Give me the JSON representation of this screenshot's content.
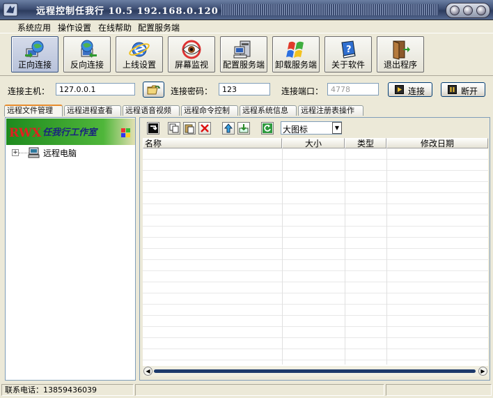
{
  "window": {
    "title": "远程控制任我行 10.5  192.168.0.120",
    "icon": "app-logo-icon"
  },
  "menu": [
    "系统应用",
    "操作设置",
    "在线帮助",
    "配置服务端"
  ],
  "toolbar": [
    {
      "label": "正向连接",
      "icon": "globe-connect-icon",
      "active": true
    },
    {
      "label": "反向连接",
      "icon": "globe-reverse-icon",
      "active": false
    },
    {
      "label": "上线设置",
      "icon": "ie-globe-icon",
      "active": false
    },
    {
      "label": "屏幕监视",
      "icon": "eye-monitor-icon",
      "active": false
    },
    {
      "label": "配置服务端",
      "icon": "computer-config-icon",
      "active": false
    },
    {
      "label": "卸载服务端",
      "icon": "uninstall-flag-icon",
      "active": false
    },
    {
      "label": "关于软件",
      "icon": "help-book-icon",
      "active": false
    },
    {
      "label": "退出程序",
      "icon": "exit-door-icon",
      "active": false
    }
  ],
  "connection": {
    "host_label": "连接主机：",
    "host_value": "127.0.0.1",
    "password_label": "连接密码：",
    "password_value": "123",
    "port_label": "连接端口：",
    "port_value": "4778",
    "connect_label": "连接",
    "disconnect_label": "断开"
  },
  "tabs": [
    "远程文件管理",
    "远程进程查看",
    "远程语音视频",
    "远程命令控制",
    "远程系统信息",
    "远程注册表操作"
  ],
  "banner": {
    "text": "任我行工作室",
    "logo": "RWX"
  },
  "tree": {
    "root": "远程电脑",
    "expander": "+"
  },
  "file_toolbar": {
    "view_select": "大图标"
  },
  "columns": [
    "名称",
    "大小",
    "类型",
    "修改日期"
  ],
  "status": {
    "phone": "联系电话：13859436039"
  },
  "colors": {
    "title_bg": "#3d4e73",
    "accent_tab": "#e68b2c",
    "scroll_thumb": "#1d3a6b"
  }
}
